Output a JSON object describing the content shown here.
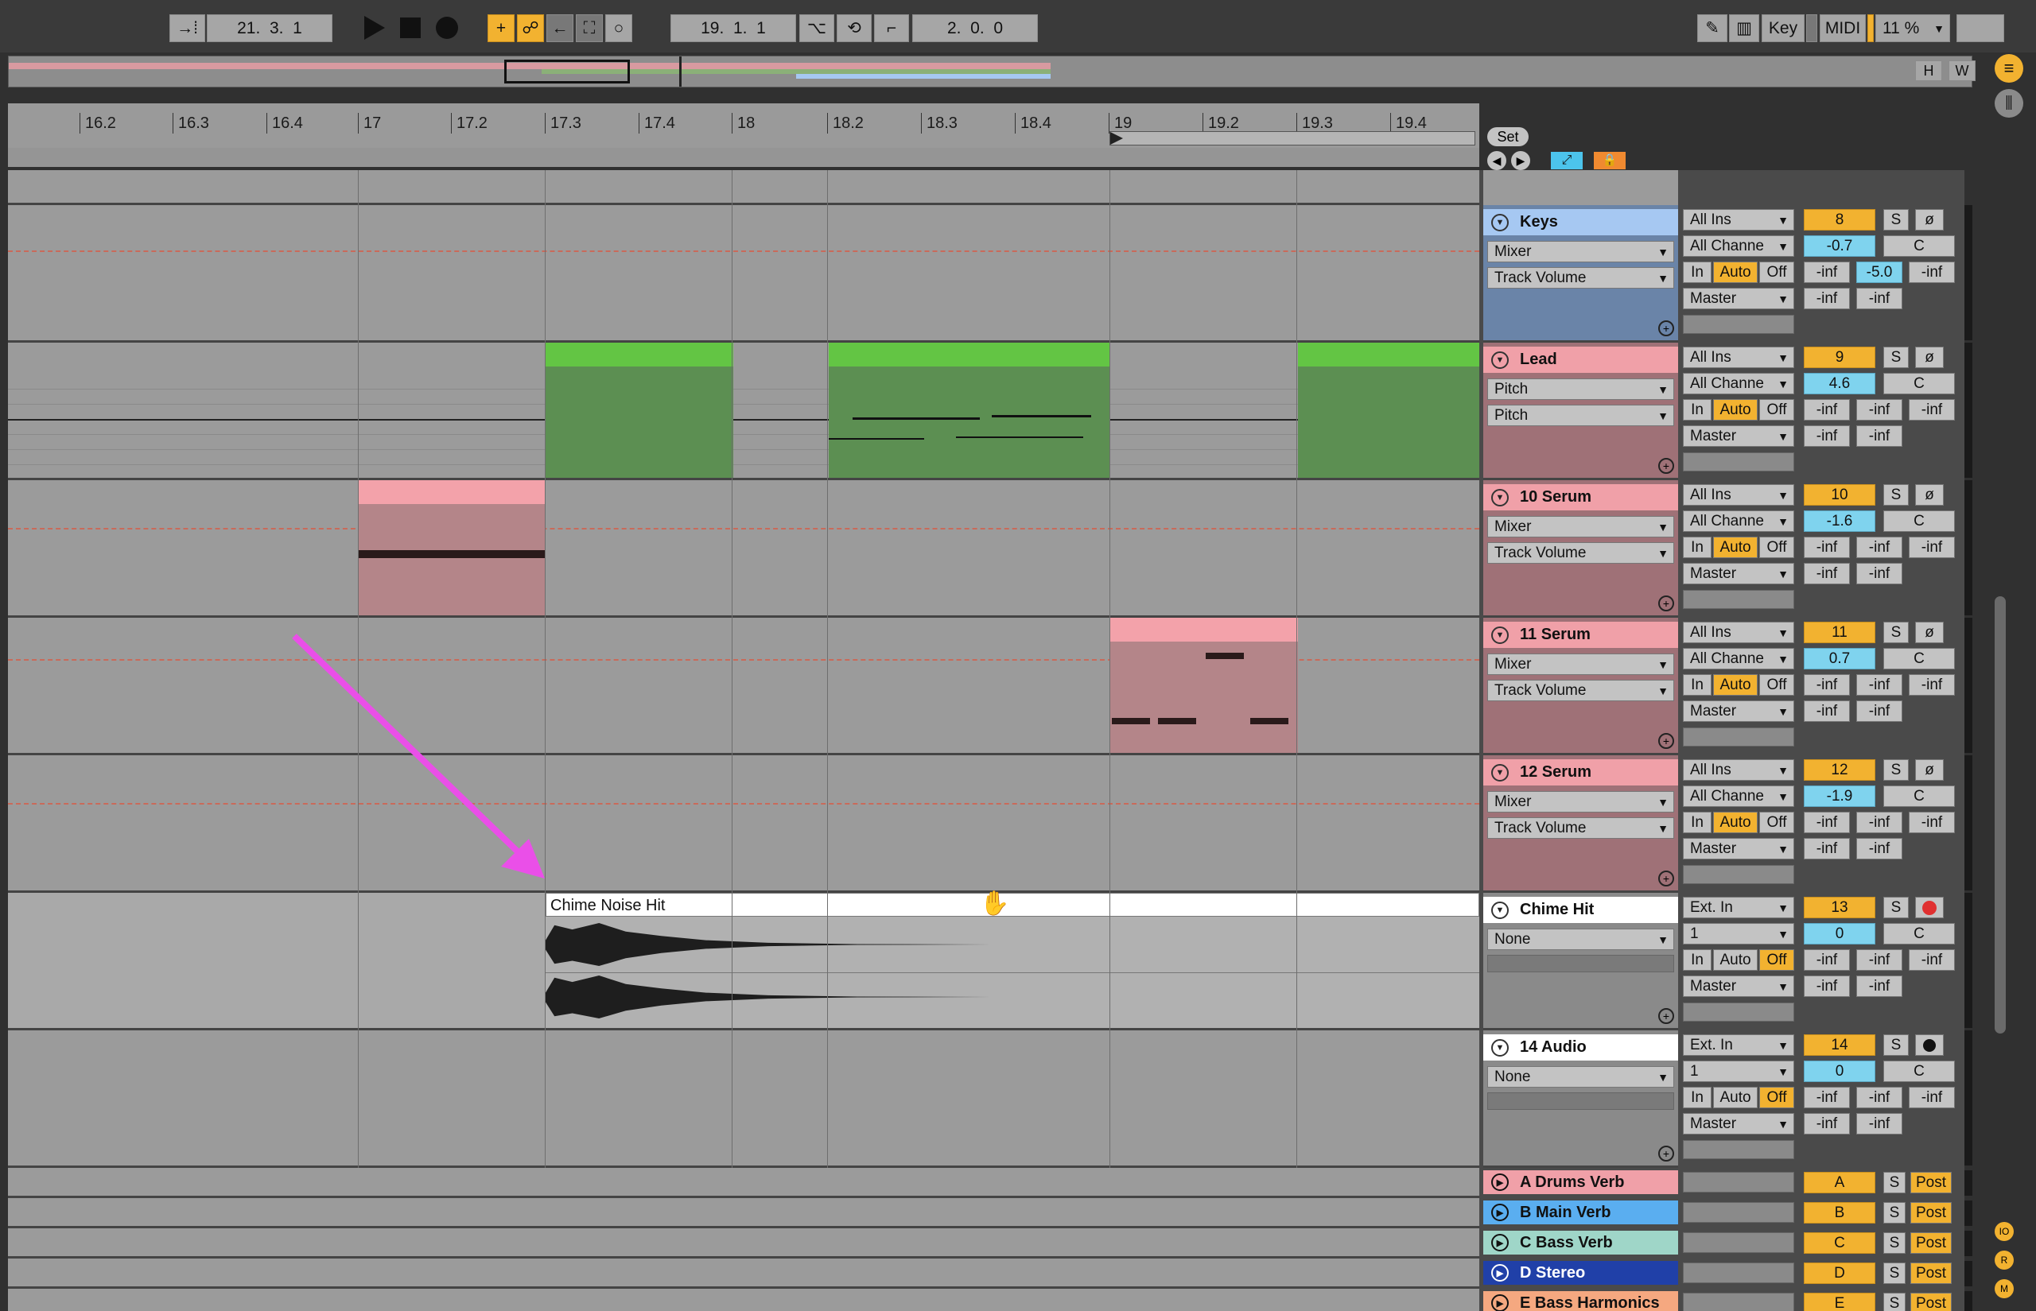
{
  "transport": {
    "position": "21.  3.  1",
    "loop_start": "19.  1.  1",
    "loop_length": "2.  0.  0",
    "key_label": "Key",
    "midi_label": "MIDI",
    "cpu": "11 %"
  },
  "overview": {
    "h_label": "H",
    "w_label": "W"
  },
  "ruler": {
    "ticks": [
      "16.2",
      "16.3",
      "16.4",
      "17",
      "17.2",
      "17.3",
      "17.4",
      "18",
      "18.2",
      "18.3",
      "18.4",
      "19",
      "19.2",
      "19.3",
      "19.4"
    ],
    "set_label": "Set"
  },
  "tracks": [
    {
      "name": "Keys",
      "color": "#a6c8f2",
      "device": "Mixer",
      "control": "Track Volume",
      "input": "All Ins",
      "channel": "All Channe",
      "monitor": [
        "In",
        "Auto",
        "Off"
      ],
      "output": "Master",
      "number": "8",
      "volume": "-0.7",
      "pan": "C",
      "send_a": "-inf",
      "send_b": "-5.0",
      "send_c": "-inf",
      "peak_l": "-inf",
      "peak_r": "-inf"
    },
    {
      "name": "Lead",
      "color": "#f0a0a8",
      "device": "Pitch",
      "control": "Pitch",
      "input": "All Ins",
      "channel": "All Channe",
      "monitor": [
        "In",
        "Auto",
        "Off"
      ],
      "output": "Master",
      "number": "9",
      "volume": "4.6",
      "pan": "C",
      "send_a": "-inf",
      "send_b": "-inf",
      "send_c": "-inf",
      "peak_l": "-inf",
      "peak_r": "-inf"
    },
    {
      "name": "10 Serum",
      "color": "#f0a0a8",
      "device": "Mixer",
      "control": "Track Volume",
      "input": "All Ins",
      "channel": "All Channe",
      "monitor": [
        "In",
        "Auto",
        "Off"
      ],
      "output": "Master",
      "number": "10",
      "volume": "-1.6",
      "pan": "C",
      "send_a": "-inf",
      "send_b": "-inf",
      "send_c": "-inf",
      "peak_l": "-inf",
      "peak_r": "-inf"
    },
    {
      "name": "11 Serum",
      "color": "#f0a0a8",
      "device": "Mixer",
      "control": "Track Volume",
      "input": "All Ins",
      "channel": "All Channe",
      "monitor": [
        "In",
        "Auto",
        "Off"
      ],
      "output": "Master",
      "number": "11",
      "volume": "0.7",
      "pan": "C",
      "send_a": "-inf",
      "send_b": "-inf",
      "send_c": "-inf",
      "peak_l": "-inf",
      "peak_r": "-inf"
    },
    {
      "name": "12 Serum",
      "color": "#f0a0a8",
      "device": "Mixer",
      "control": "Track Volume",
      "input": "All Ins",
      "channel": "All Channe",
      "monitor": [
        "In",
        "Auto",
        "Off"
      ],
      "output": "Master",
      "number": "12",
      "volume": "-1.9",
      "pan": "C",
      "send_a": "-inf",
      "send_b": "-inf",
      "send_c": "-inf",
      "peak_l": "-inf",
      "peak_r": "-inf"
    },
    {
      "name": "Chime Hit",
      "color": "#ffffff",
      "device": "None",
      "control": "",
      "input": "Ext. In",
      "channel": "1",
      "monitor": [
        "In",
        "Auto",
        "Off"
      ],
      "output": "Master",
      "number": "13",
      "volume": "0",
      "pan": "C",
      "send_a": "-inf",
      "send_b": "-inf",
      "send_c": "-inf",
      "peak_l": "-inf",
      "peak_r": "-inf"
    },
    {
      "name": "14 Audio",
      "color": "#ffffff",
      "device": "None",
      "control": "",
      "input": "Ext. In",
      "channel": "1",
      "monitor": [
        "In",
        "Auto",
        "Off"
      ],
      "output": "Master",
      "number": "14",
      "volume": "0",
      "pan": "C",
      "send_a": "-inf",
      "send_b": "-inf",
      "send_c": "-inf",
      "peak_l": "-inf",
      "peak_r": "-inf"
    }
  ],
  "clips": {
    "chime": "Chime Noise Hit"
  },
  "returns": [
    {
      "name": "A Drums Verb",
      "color": "#f0a0a8",
      "letter": "A",
      "solo": "S",
      "post": "Post"
    },
    {
      "name": "B Main Verb",
      "color": "#5aaef0",
      "letter": "B",
      "solo": "S",
      "post": "Post"
    },
    {
      "name": "C Bass Verb",
      "color": "#9fd6c8",
      "letter": "C",
      "solo": "S",
      "post": "Post"
    },
    {
      "name": "D Stereo",
      "color": "#2040a8",
      "letter": "D",
      "solo": "S",
      "post": "Post"
    },
    {
      "name": "E Bass Harmonics",
      "color": "#f5a880",
      "letter": "E",
      "solo": "S",
      "post": "Post"
    }
  ],
  "side": {
    "io": "IO",
    "r": "R",
    "m": "M"
  }
}
